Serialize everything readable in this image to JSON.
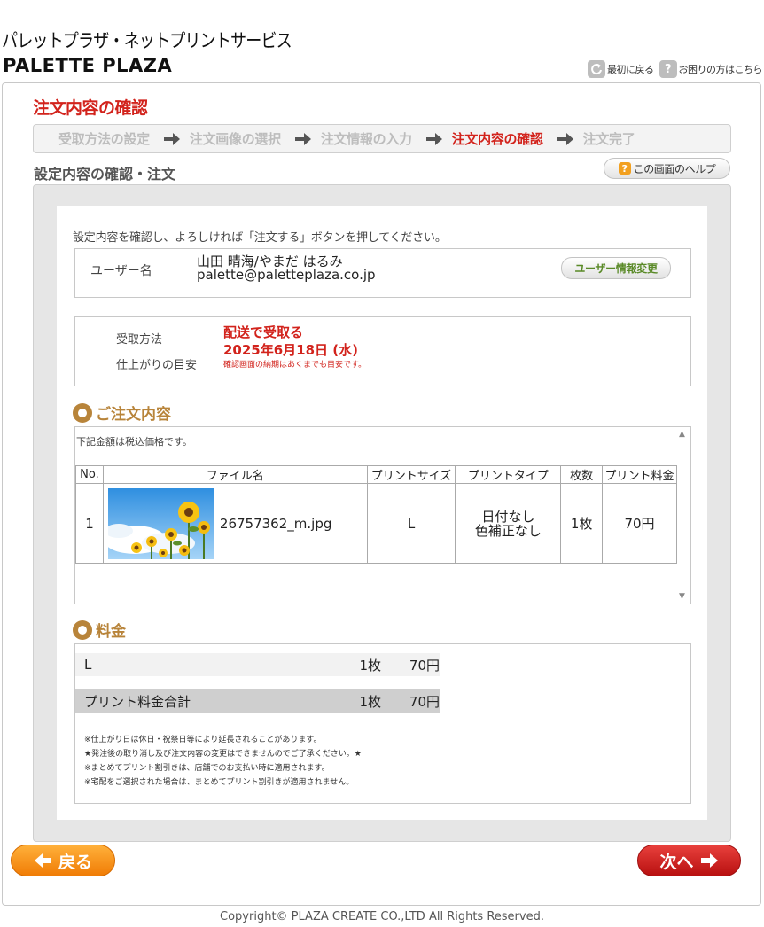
{
  "header": {
    "brand_jp": "パレットプラザ・ネットプリントサービス",
    "brand_en": "PALETTE PLAZA",
    "link_home": "最初に戻る",
    "link_help": "お困りの方はこちら"
  },
  "page_title": "注文内容の確認",
  "steps": [
    {
      "label": "受取方法の設定",
      "active": false
    },
    {
      "label": "注文画像の選択",
      "active": false
    },
    {
      "label": "注文情報の入力",
      "active": false
    },
    {
      "label": "注文内容の確認",
      "active": true
    },
    {
      "label": "注文完了",
      "active": false
    }
  ],
  "section_title": "設定内容の確認・注文",
  "help_button": "この画面のヘルプ",
  "instruction": "設定内容を確認し、よろしければ「注文する」ボタンを押してください。",
  "user": {
    "label": "ユーザー名",
    "name": "山田 晴海/やまだ はるみ",
    "email": "palette@paletteplaza.co.jp",
    "change_button": "ユーザー情報変更"
  },
  "receive": {
    "method_label": "受取方法",
    "method_value": "配送で受取る",
    "due_label": "仕上がりの目安",
    "due_value": "2025年6月18日 (水)",
    "due_note": "確認画面の納期はあくまでも目安です。"
  },
  "order": {
    "heading": "ご注文内容",
    "tax_note": "下記金額は税込価格です。",
    "columns": [
      "No.",
      "ファイル名",
      "プリントサイズ",
      "プリントタイプ",
      "枚数",
      "プリント料金"
    ],
    "rows": [
      {
        "no": "1",
        "file": "26757362_m.jpg",
        "size": "L",
        "type_line1": "日付なし",
        "type_line2": "色補正なし",
        "qty": "1枚",
        "price": "70円"
      }
    ]
  },
  "fee": {
    "heading": "料金",
    "rows": [
      {
        "name": "L",
        "qty": "1枚",
        "price": "70円"
      },
      {
        "name": "プリント料金合計",
        "qty": "1枚",
        "price": "70円"
      }
    ],
    "notes": [
      "※仕上がり日は休日・祝祭日等により延長されることがあります。",
      "★発注後の取り消し及び注文内容の変更はできませんのでご了承ください。★",
      "※まとめてプリント割引きは、店舗でのお支払い時に適用されます。",
      "※宅配をご選択された場合は、まとめてプリント割引きが適用されません。"
    ]
  },
  "buttons": {
    "back": "戻る",
    "next": "次へ"
  },
  "footer": {
    "copyright": "Copyright© PLAZA CREATE CO.,LTD All Rights Reserved."
  },
  "colors": {
    "accent_red": "#d2231c",
    "heading_gold": "#b8843a",
    "back_orange": "#f07c05",
    "next_red": "#b81010"
  },
  "icons": [
    "home-icon",
    "help-icon",
    "step-arrow-icon",
    "section-bullet-icon",
    "arrow-left-icon",
    "arrow-right-icon"
  ]
}
